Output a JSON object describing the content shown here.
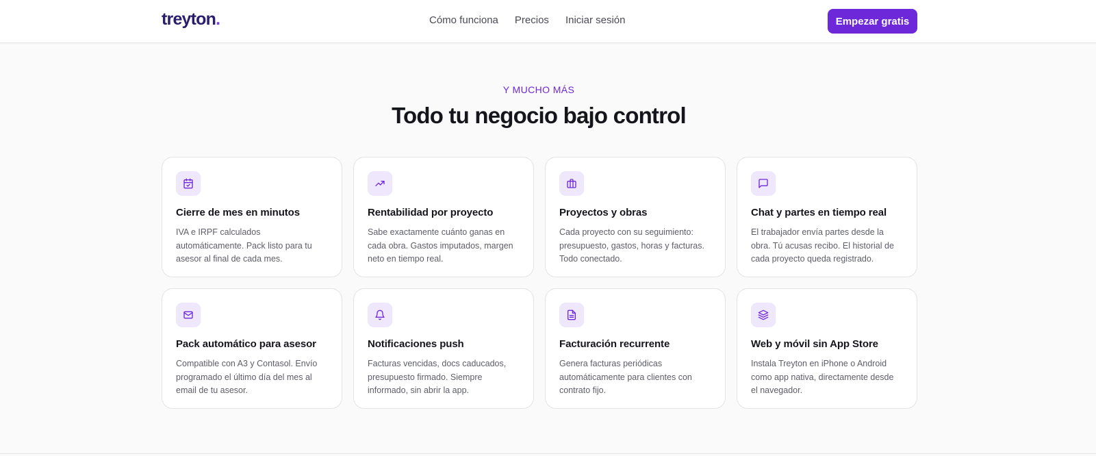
{
  "nav": {
    "logo_text": "treyton",
    "logo_dot": ".",
    "links": [
      "Cómo funciona",
      "Precios",
      "Iniciar sesión"
    ],
    "cta_label": "Empezar gratis"
  },
  "section": {
    "eyebrow": "Y MUCHO MÁS",
    "title": "Todo tu negocio bajo control"
  },
  "features": [
    {
      "icon": "calendar-check-icon",
      "title": "Cierre de mes en minutos",
      "description": "IVA e IRPF calculados automáticamente. Pack listo para tu asesor al final de cada mes."
    },
    {
      "icon": "trending-up-icon",
      "title": "Rentabilidad por proyecto",
      "description": "Sabe exactamente cuánto ganas en cada obra. Gastos imputados, margen neto en tiempo real."
    },
    {
      "icon": "briefcase-icon",
      "title": "Proyectos y obras",
      "description": "Cada proyecto con su seguimiento: presupuesto, gastos, horas y facturas. Todo conectado."
    },
    {
      "icon": "chat-icon",
      "title": "Chat y partes en tiempo real",
      "description": "El trabajador envía partes desde la obra. Tú acusas recibo. El historial de cada proyecto queda registrado."
    },
    {
      "icon": "mail-icon",
      "title": "Pack automático para asesor",
      "description": "Compatible con A3 y Contasol. Envío programado el último día del mes al email de tu asesor."
    },
    {
      "icon": "bell-icon",
      "title": "Notificaciones push",
      "description": "Facturas vencidas, docs caducados, presupuesto firmado. Siempre informado, sin abrir la app."
    },
    {
      "icon": "document-icon",
      "title": "Facturación recurrente",
      "description": "Genera facturas periódicas automáticamente para clientes con contrato fijo."
    },
    {
      "icon": "layers-icon",
      "title": "Web y móvil sin App Store",
      "description": "Instala Treyton en iPhone o Android como app nativa, directamente desde el navegador."
    }
  ],
  "colors": {
    "accent": "#6d28d9",
    "logo": "#2a1d6b",
    "icon_bg": "#efe8fc",
    "page_bg": "#fafafa"
  }
}
